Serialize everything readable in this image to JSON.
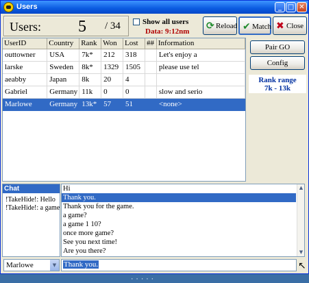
{
  "window": {
    "title": "Users"
  },
  "header": {
    "users_label": "Users:",
    "users_count": "5",
    "users_total": "/ 34",
    "show_all_label": "Show all users",
    "data_text": "Data: 9:12nm"
  },
  "toolbar": {
    "reload_label": "Reload",
    "match_label": "Match",
    "close_label": "Close"
  },
  "table": {
    "columns": [
      "UserID",
      "Country",
      "Rank",
      "Won",
      "Lost",
      "##",
      "Information"
    ],
    "rows": [
      [
        "outtowner",
        "USA",
        "7k*",
        "212",
        "318",
        "",
        "Let's enjoy a"
      ],
      [
        "larske",
        "Sweden",
        "8k*",
        "1329",
        "1505",
        "",
        "please use tel"
      ],
      [
        "aeabby",
        "Japan",
        "8k",
        "20",
        "4",
        "",
        ""
      ],
      [
        "Gabriel",
        "Germany",
        "11k",
        "0",
        "0",
        "",
        "slow and serio"
      ],
      [
        "Marlowe",
        "Germany",
        "13k*",
        "57",
        "51",
        "",
        "<none>"
      ]
    ],
    "selected_row": 4
  },
  "side": {
    "pair_go_label": "Pair GO",
    "config_label": "Config",
    "rank_range_label": "Rank range",
    "rank_range_value": "7k - 13k"
  },
  "chat": {
    "header": "Chat",
    "lines": [
      "!TakeHide!: Hello",
      "!TakeHide!: a game"
    ]
  },
  "messages": {
    "items": [
      "Hi",
      "Thank you.",
      "Thank you for the game.",
      "a game?",
      "a game 1 10?",
      "once more game?",
      "See you next time!",
      "Are you there?"
    ],
    "selected": 1
  },
  "bottom": {
    "user_select_value": "Marlowe",
    "chat_input_value": "Thank you."
  },
  "icons": {
    "reload": "reload-icon",
    "match": "checkmark-icon",
    "close": "x-icon"
  },
  "colors": {
    "selection": "#316ac5",
    "titlebar": "#0a5ae0",
    "data_text": "#b00000",
    "rank_range": "#0030a0"
  }
}
